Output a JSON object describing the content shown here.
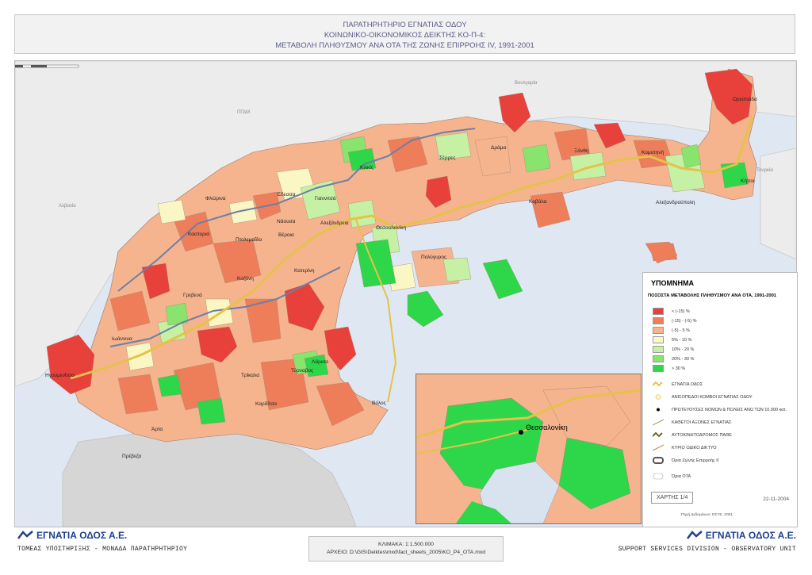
{
  "header": {
    "line1": "ΠΑΡΑΤΗΡΗΤΗΡΙΟ ΕΓΝΑΤΙΑΣ ΟΔΟΥ",
    "line2": "ΚΟΙΝΩΝΙΚΟ-ΟΙΚΟΝΟΜΙΚΟΣ ΔΕΙΚΤΗΣ ΚΟ-Π-4:",
    "line3": "ΜΕΤΑΒΟΛΗ ΠΛΗΘΥΣΜΟΥ ΑΝΑ ΟΤΑ ΤΗΣ ΖΩΝΗΣ ΕΠΙΡΡΟΗΣ IV, 1991-2001"
  },
  "map": {
    "countries": [
      "ΠΓΔΜ",
      "Bουλγαρία",
      "Αλβανία",
      "Τουρκία"
    ],
    "cities": [
      {
        "name": "Ορεστιάδα"
      },
      {
        "name": "Δράμα"
      },
      {
        "name": "Ξάνθη"
      },
      {
        "name": "Κομοτηνή"
      },
      {
        "name": "Σέρρες"
      },
      {
        "name": "Κιλκίς"
      },
      {
        "name": "Καβάλα"
      },
      {
        "name": "Κήποι"
      },
      {
        "name": "Αλεξανδρούπολη"
      },
      {
        "name": "Φλώρινα"
      },
      {
        "name": "Έδεσσα"
      },
      {
        "name": "Γιαννιτσά"
      },
      {
        "name": "Νάουσα"
      },
      {
        "name": "Αλεξάνδρεια"
      },
      {
        "name": "Θεσσαλονίκη"
      },
      {
        "name": "Καστοριά"
      },
      {
        "name": "Πτολεμαΐδα"
      },
      {
        "name": "Βέροια"
      },
      {
        "name": "Πολύγυρος"
      },
      {
        "name": "Κοζάνη"
      },
      {
        "name": "Κατερίνη"
      },
      {
        "name": "Γρεβενά"
      },
      {
        "name": "Ιωάννινα"
      },
      {
        "name": "Ηγουμενίτσα"
      },
      {
        "name": "Τύρναβος"
      },
      {
        "name": "Λάρισα"
      },
      {
        "name": "Τρίκαλα"
      },
      {
        "name": "Καρδίτσα"
      },
      {
        "name": "Βόλος"
      },
      {
        "name": "Άρτα"
      },
      {
        "name": "Πρέβεζα"
      }
    ]
  },
  "legend": {
    "title": "ΥΠΟΜΝΗΜΑ",
    "subtitle": "ΠΟΣΟΣΤΑ ΜΕΤΑΒΟΛΗΣ ΠΛΗΘΥΣΜΟΥ ΑΝΑ ΟΤΑ, 1991-2001",
    "classes": [
      {
        "label": "< (-15) %",
        "color": "#e8403a"
      },
      {
        "label": "(-15) - (-5) %",
        "color": "#ee7d5a"
      },
      {
        "label": "(-5) - 5 %",
        "color": "#f5b48e"
      },
      {
        "label": "5% - 10 %",
        "color": "#fbf7c4"
      },
      {
        "label": "10% - 20 %",
        "color": "#c6f0a4"
      },
      {
        "label": "20% - 30 %",
        "color": "#88e46c"
      },
      {
        "label": "> 30 %",
        "color": "#2ed64a"
      }
    ],
    "symbols": [
      {
        "label": "ΕΓΝΑΤΙΑ ΟΔΟΣ"
      },
      {
        "label": "ΑΝΙΣΟΠΕΔΟΙ ΚΟΜΒΟΙ ΕΓΝΑΤΙΑΣ ΟΔΟΥ"
      },
      {
        "label": "ΠΡΩΤΕΥΟΥΣΕΣ ΝΟΜΩΝ & ΠΟΛΕΙΣ ΑΝΩ ΤΩΝ 10.000 κατ."
      },
      {
        "label": "ΚΑΘΕΤΟΙ ΑΞΟΝΕΣ ΕΓΝΑΤΙΑΣ"
      },
      {
        "label": "ΑΥΤΟΚΙΝΗΤΟΔΡΟΜΟΣ ΠΑΘΕ"
      },
      {
        "label": "ΚΥΡΙΟ ΟΔΙΚΟ ΔΙΚΤΥΟ"
      },
      {
        "label": "Όρια Ζώνης Επιρροής II"
      },
      {
        "label": "Όρια ΟΤΑ"
      }
    ],
    "map_number": "ΧΑΡΤΗΣ 1/4",
    "date": "22-11-2004",
    "source": "Πηγή Δεδομένων: ΕΣΥΕ, 2001"
  },
  "inset": {
    "city": "Θεσσαλονίκη"
  },
  "scale": {
    "ticks": [
      "0",
      "10",
      "20",
      "40",
      "60"
    ],
    "units": "km",
    "north": "N"
  },
  "footer": {
    "logo_left": "ΕΓΝΑΤΙΑ ΟΔΟΣ Α.Ε.",
    "tagline_left": "ΤΟΜΕΑΣ ΥΠΟΣΤΗΡΙΞΗΣ - ΜΟΝΑΔΑ ΠΑΡΑΤΗΡΗΤΗΡΙΟΥ",
    "scale_line": "ΚΛΙΜΑΚΑ: 1:1.500.000",
    "file_line": "ΑΡΧΕΙΟ: D:\\GIS\\Deiktes\\mxd\\fact_sheets_2005\\KO_P4_OTA.mxd",
    "logo_right": "ΕΓΝΑΤΙΑ ΟΔΟΣ Α.Ε.",
    "tagline_right": "SUPPORT SERVICES DIVISION - OBSERVATORY UNIT"
  }
}
